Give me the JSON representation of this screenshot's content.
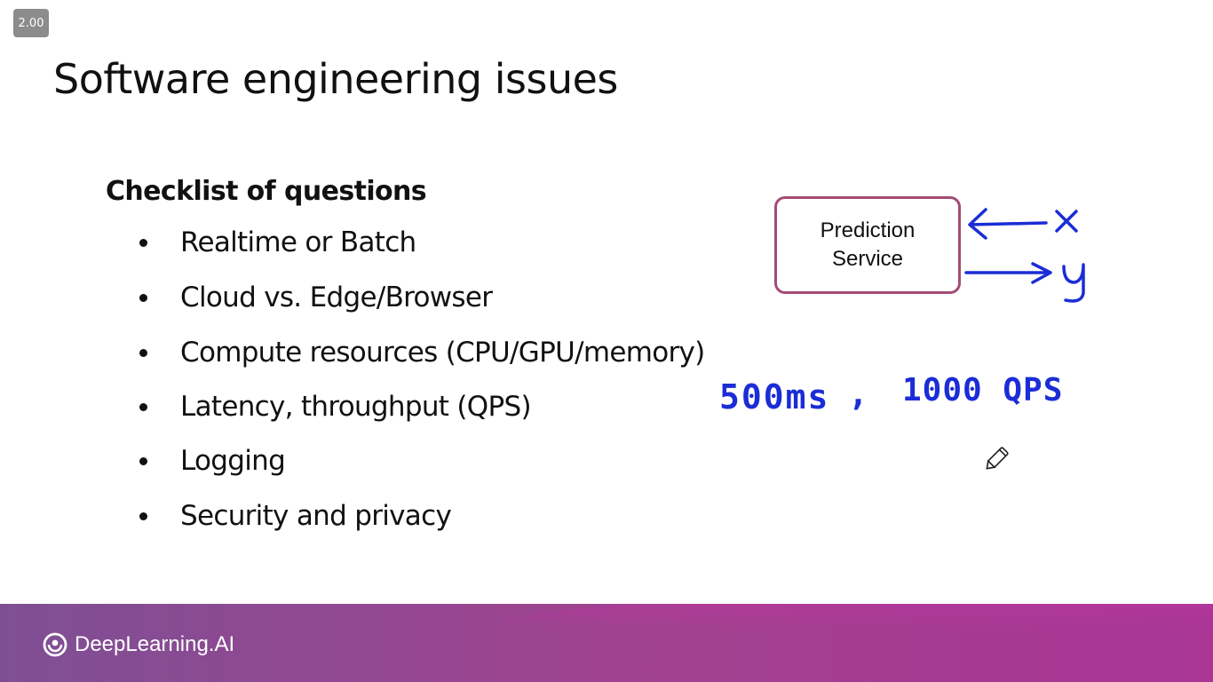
{
  "player": {
    "speed_label": "2.00"
  },
  "slide": {
    "title": "Software engineering issues",
    "checklist_heading": "Checklist of questions",
    "bullets": [
      "Realtime or Batch",
      "Cloud vs. Edge/Browser",
      "Compute resources (CPU/GPU/memory)",
      "Latency, throughput (QPS)",
      "Logging",
      "Security and privacy"
    ],
    "diagram": {
      "box_label": "Prediction\nService",
      "box_border_color": "#a44b76"
    },
    "annotations": {
      "input_label": "x",
      "output_label": "y",
      "latency_note": "500ms",
      "separator": ",",
      "throughput_note": "1000 QPS",
      "ink_color": "#1b2dd6",
      "cursor_icon": "pencil-icon"
    }
  },
  "footer": {
    "brand_name": "DeepLearning.AI",
    "brand_icon": "deeplearning-logo-icon"
  }
}
